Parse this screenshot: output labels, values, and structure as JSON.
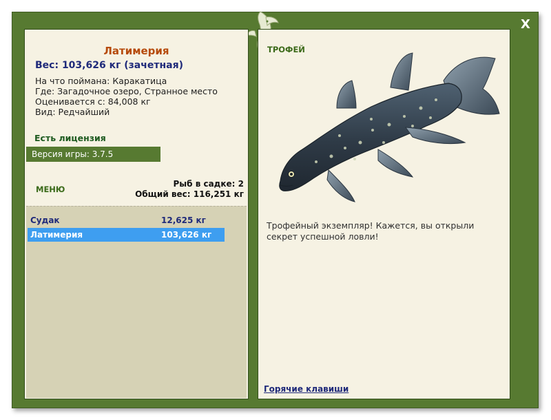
{
  "window": {
    "close_label": "X"
  },
  "fish": {
    "title": "Латимерия",
    "weight_line": "Вес: 103,626 кг (зачетная)",
    "bait_line": "На что поймана: Каракатица",
    "location_line": "Где: Загадочное озеро, Странное место",
    "value_line": "Оценивается с: 84,008 кг",
    "kind_line": "Вид: Редчайший"
  },
  "license": {
    "label": "Есть лицензия"
  },
  "version": {
    "label": "Версия игры: 3.7.5"
  },
  "menu": {
    "label": "МЕНЮ"
  },
  "keepnet": {
    "count_line": "Рыб в садке: 2",
    "total_line": "Общий вес: 116,251 кг"
  },
  "catch_list": [
    {
      "name": "Судак",
      "weight": "12,625 кг",
      "selected": false
    },
    {
      "name": "Латимерия",
      "weight": "103,626 кг",
      "selected": true
    }
  ],
  "trophy": {
    "label": "ТРОФЕЙ",
    "description": "Трофейный экземпляр! Кажется, вы открыли секрет успешной ловли!"
  },
  "footer": {
    "hotkeys_label": "Горячие клавиши"
  },
  "colors": {
    "frame_green": "#577a31",
    "panel_bg": "#f6f2e3",
    "list_bg": "#d6d2b5",
    "selection_blue": "#3e9ef0",
    "title_orange": "#b64a0b",
    "weight_navy": "#1f2a7a"
  },
  "icons": {
    "logo": "fish-logo-icon",
    "close": "close-icon",
    "fish_image": "coelacanth-image"
  }
}
